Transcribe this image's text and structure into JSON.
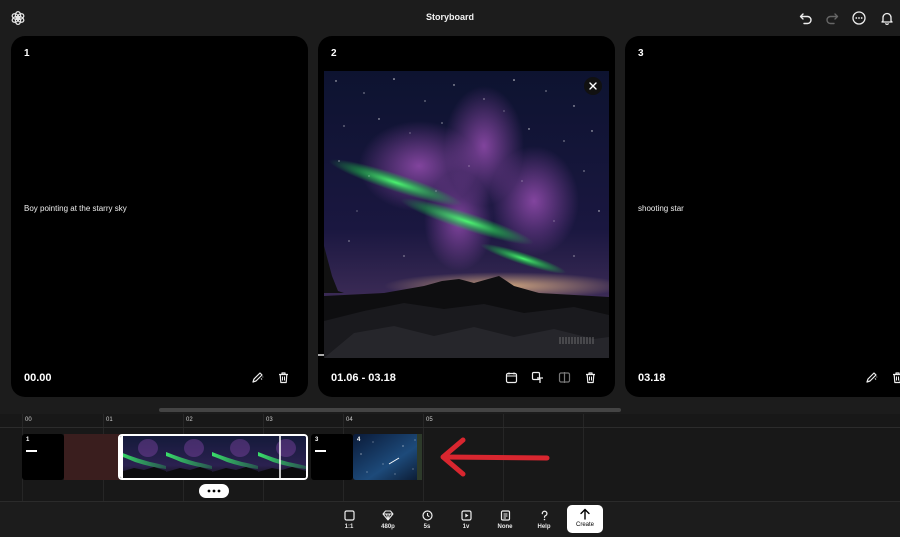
{
  "header": {
    "title": "Storyboard",
    "icons": [
      "logo-icon",
      "undo-icon",
      "redo-icon",
      "more-icon",
      "bell-icon"
    ]
  },
  "cards": [
    {
      "number": "1",
      "prompt": "Boy pointing at the starry sky",
      "time": "00.00"
    },
    {
      "number": "2",
      "prompt": "",
      "time": "01.06 - 03.18"
    },
    {
      "number": "3",
      "prompt": "shooting star",
      "time": "03.18"
    }
  ],
  "timeline": {
    "ticks": [
      "00",
      "01",
      "02",
      "03",
      "04",
      "05"
    ],
    "clips": [
      {
        "label": "1"
      },
      {
        "label": "3"
      },
      {
        "label": "4"
      }
    ]
  },
  "toolbar": {
    "items": [
      {
        "label": "1:1",
        "icon": "square-icon"
      },
      {
        "label": "480p",
        "icon": "diamond-icon"
      },
      {
        "label": "5s",
        "icon": "clock-icon"
      },
      {
        "label": "1v",
        "icon": "video-icon"
      },
      {
        "label": "None",
        "icon": "document-icon"
      },
      {
        "label": "Help",
        "icon": "question-icon"
      }
    ],
    "create_label": "Create"
  },
  "colors": {
    "background": "#1c1c1c",
    "card": "#000000",
    "arrow": "#d8262f"
  }
}
